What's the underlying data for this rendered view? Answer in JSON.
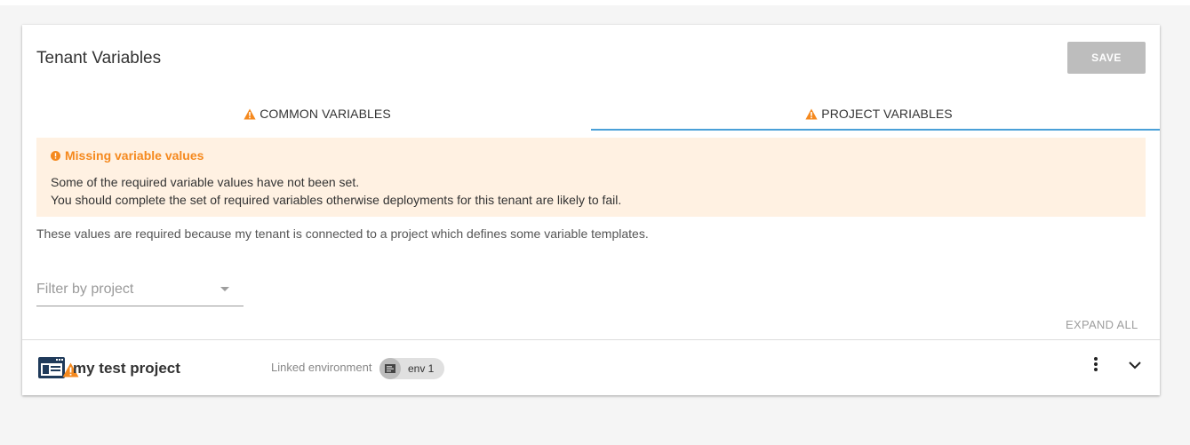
{
  "card": {
    "title": "Tenant Variables",
    "save_label": "SAVE"
  },
  "tabs": [
    {
      "label": "COMMON VARIABLES",
      "icon": "warning-icon",
      "active": false
    },
    {
      "label": "PROJECT VARIABLES",
      "icon": "warning-icon",
      "active": true
    }
  ],
  "alert": {
    "title": "Missing variable values",
    "line1": "Some of the required variable values have not been set.",
    "line2": "You should complete the set of required variables otherwise deployments for this tenant are likely to fail."
  },
  "required_note": "These values are required because my tenant is connected to a project which defines some variable templates.",
  "filter": {
    "placeholder": "Filter by project"
  },
  "expand_all_label": "EXPAND ALL",
  "project_row": {
    "name": "my test project",
    "linked_label": "Linked environment",
    "environment_chip": "env 1"
  },
  "colors": {
    "accent": "#4aa0d8",
    "warning": "#f5891e",
    "alert_bg": "#fff1e2",
    "save_disabled": "#bdbdbd",
    "project_logo": "#1f3a5a"
  }
}
